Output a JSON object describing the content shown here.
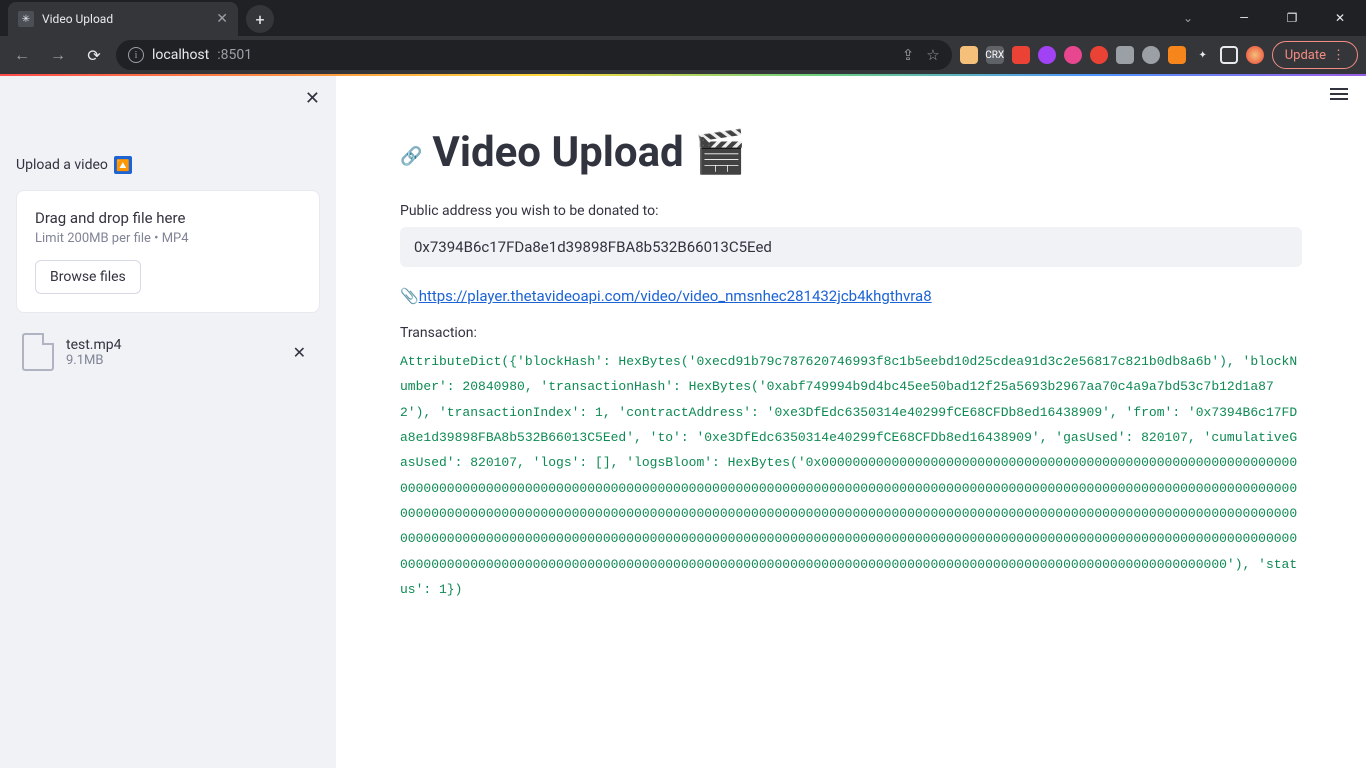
{
  "browser": {
    "tab_title": "Video Upload",
    "url_host": "localhost",
    "url_port": ":8501",
    "update_label": "Update"
  },
  "sidebar": {
    "label": "Upload a video",
    "dd_title": "Drag and drop file here",
    "dd_sub": "Limit 200MB per file • MP4",
    "browse": "Browse files",
    "file": {
      "name": "test.mp4",
      "size": "9.1MB"
    }
  },
  "main": {
    "title": "Video Upload 🎬",
    "addr_label": "Public address you wish to be donated to:",
    "addr_value": "0x7394B6c17FDa8e1d39898FBA8b532B66013C5Eed",
    "video_url": "https://player.thetavideoapi.com/video/video_nmsnhec281432jcb4khgthvra8",
    "tx_label": "Transaction:",
    "tx_text": "AttributeDict({'blockHash': HexBytes('0xecd91b79c787620746993f8c1b5eebd10d25cdea91d3c2e56817c821b0db8a6b'), 'blockNumber': 20840980, 'transactionHash': HexBytes('0xabf749994b9d4bc45ee50bad12f25a5693b2967aa70c4a9a7bd53c7b12d1a872'), 'transactionIndex': 1, 'contractAddress': '0xe3DfEdc6350314e40299fCE68CFDb8ed16438909', 'from': '0x7394B6c17FDa8e1d39898FBA8b532B66013C5Eed', 'to': '0xe3DfEdc6350314e40299fCE68CFDb8ed16438909', 'gasUsed': 820107, 'cumulativeGasUsed': 820107, 'logs': [], 'logsBloom': HexBytes('0x00000000000000000000000000000000000000000000000000000000000000000000000000000000000000000000000000000000000000000000000000000000000000000000000000000000000000000000000000000000000000000000000000000000000000000000000000000000000000000000000000000000000000000000000000000000000000000000000000000000000000000000000000000000000000000000000000000000000000000000000000000000000000000000000000000000000000000000000000000000000000000000000000000000000000000000000000000000000000000000000000000000000000000000000000000000'), 'status': 1})"
  }
}
